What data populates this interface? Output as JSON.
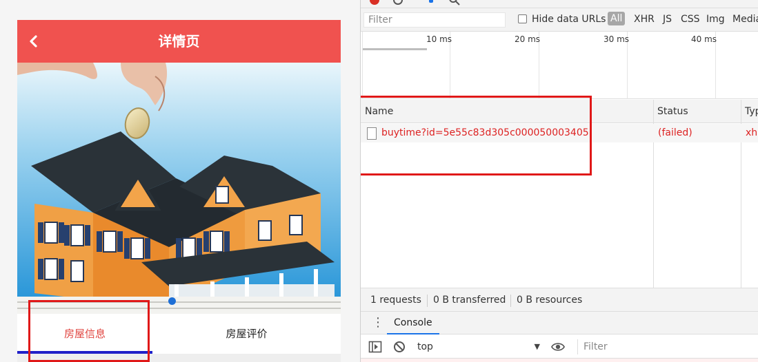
{
  "mobile": {
    "header_title": "详情页",
    "back_icon": "chevron-left-icon",
    "banner_image": "house-model-with-coin-photo",
    "tabs": [
      "房屋信息",
      "房屋评价"
    ],
    "active_tab": "房屋信息",
    "colors": {
      "header": "#f0524f",
      "active_tab_text": "#e0443f",
      "tab_indicator": "#2020c8",
      "carousel_dot": "#1e6fd6"
    }
  },
  "devtools": {
    "filter_placeholder": "Filter",
    "hide_data_urls": "Hide data URLs",
    "type_filters": [
      "All",
      "XHR",
      "JS",
      "CSS",
      "Img",
      "Media"
    ],
    "timeline_ticks": [
      "10 ms",
      "20 ms",
      "30 ms",
      "40 ms"
    ],
    "columns": [
      "Name",
      "Status",
      "Typ"
    ],
    "requests": [
      {
        "name": "buytime?id=5e55c83d305c000050003405",
        "status": "(failed)",
        "type": "xhr"
      }
    ],
    "summary": [
      "1 requests",
      "0 B transferred",
      "0 B resources"
    ],
    "drawer_tab": "Console",
    "console_context": "top",
    "console_filter_placeholder": "Filter",
    "error_color": "#d22222"
  }
}
